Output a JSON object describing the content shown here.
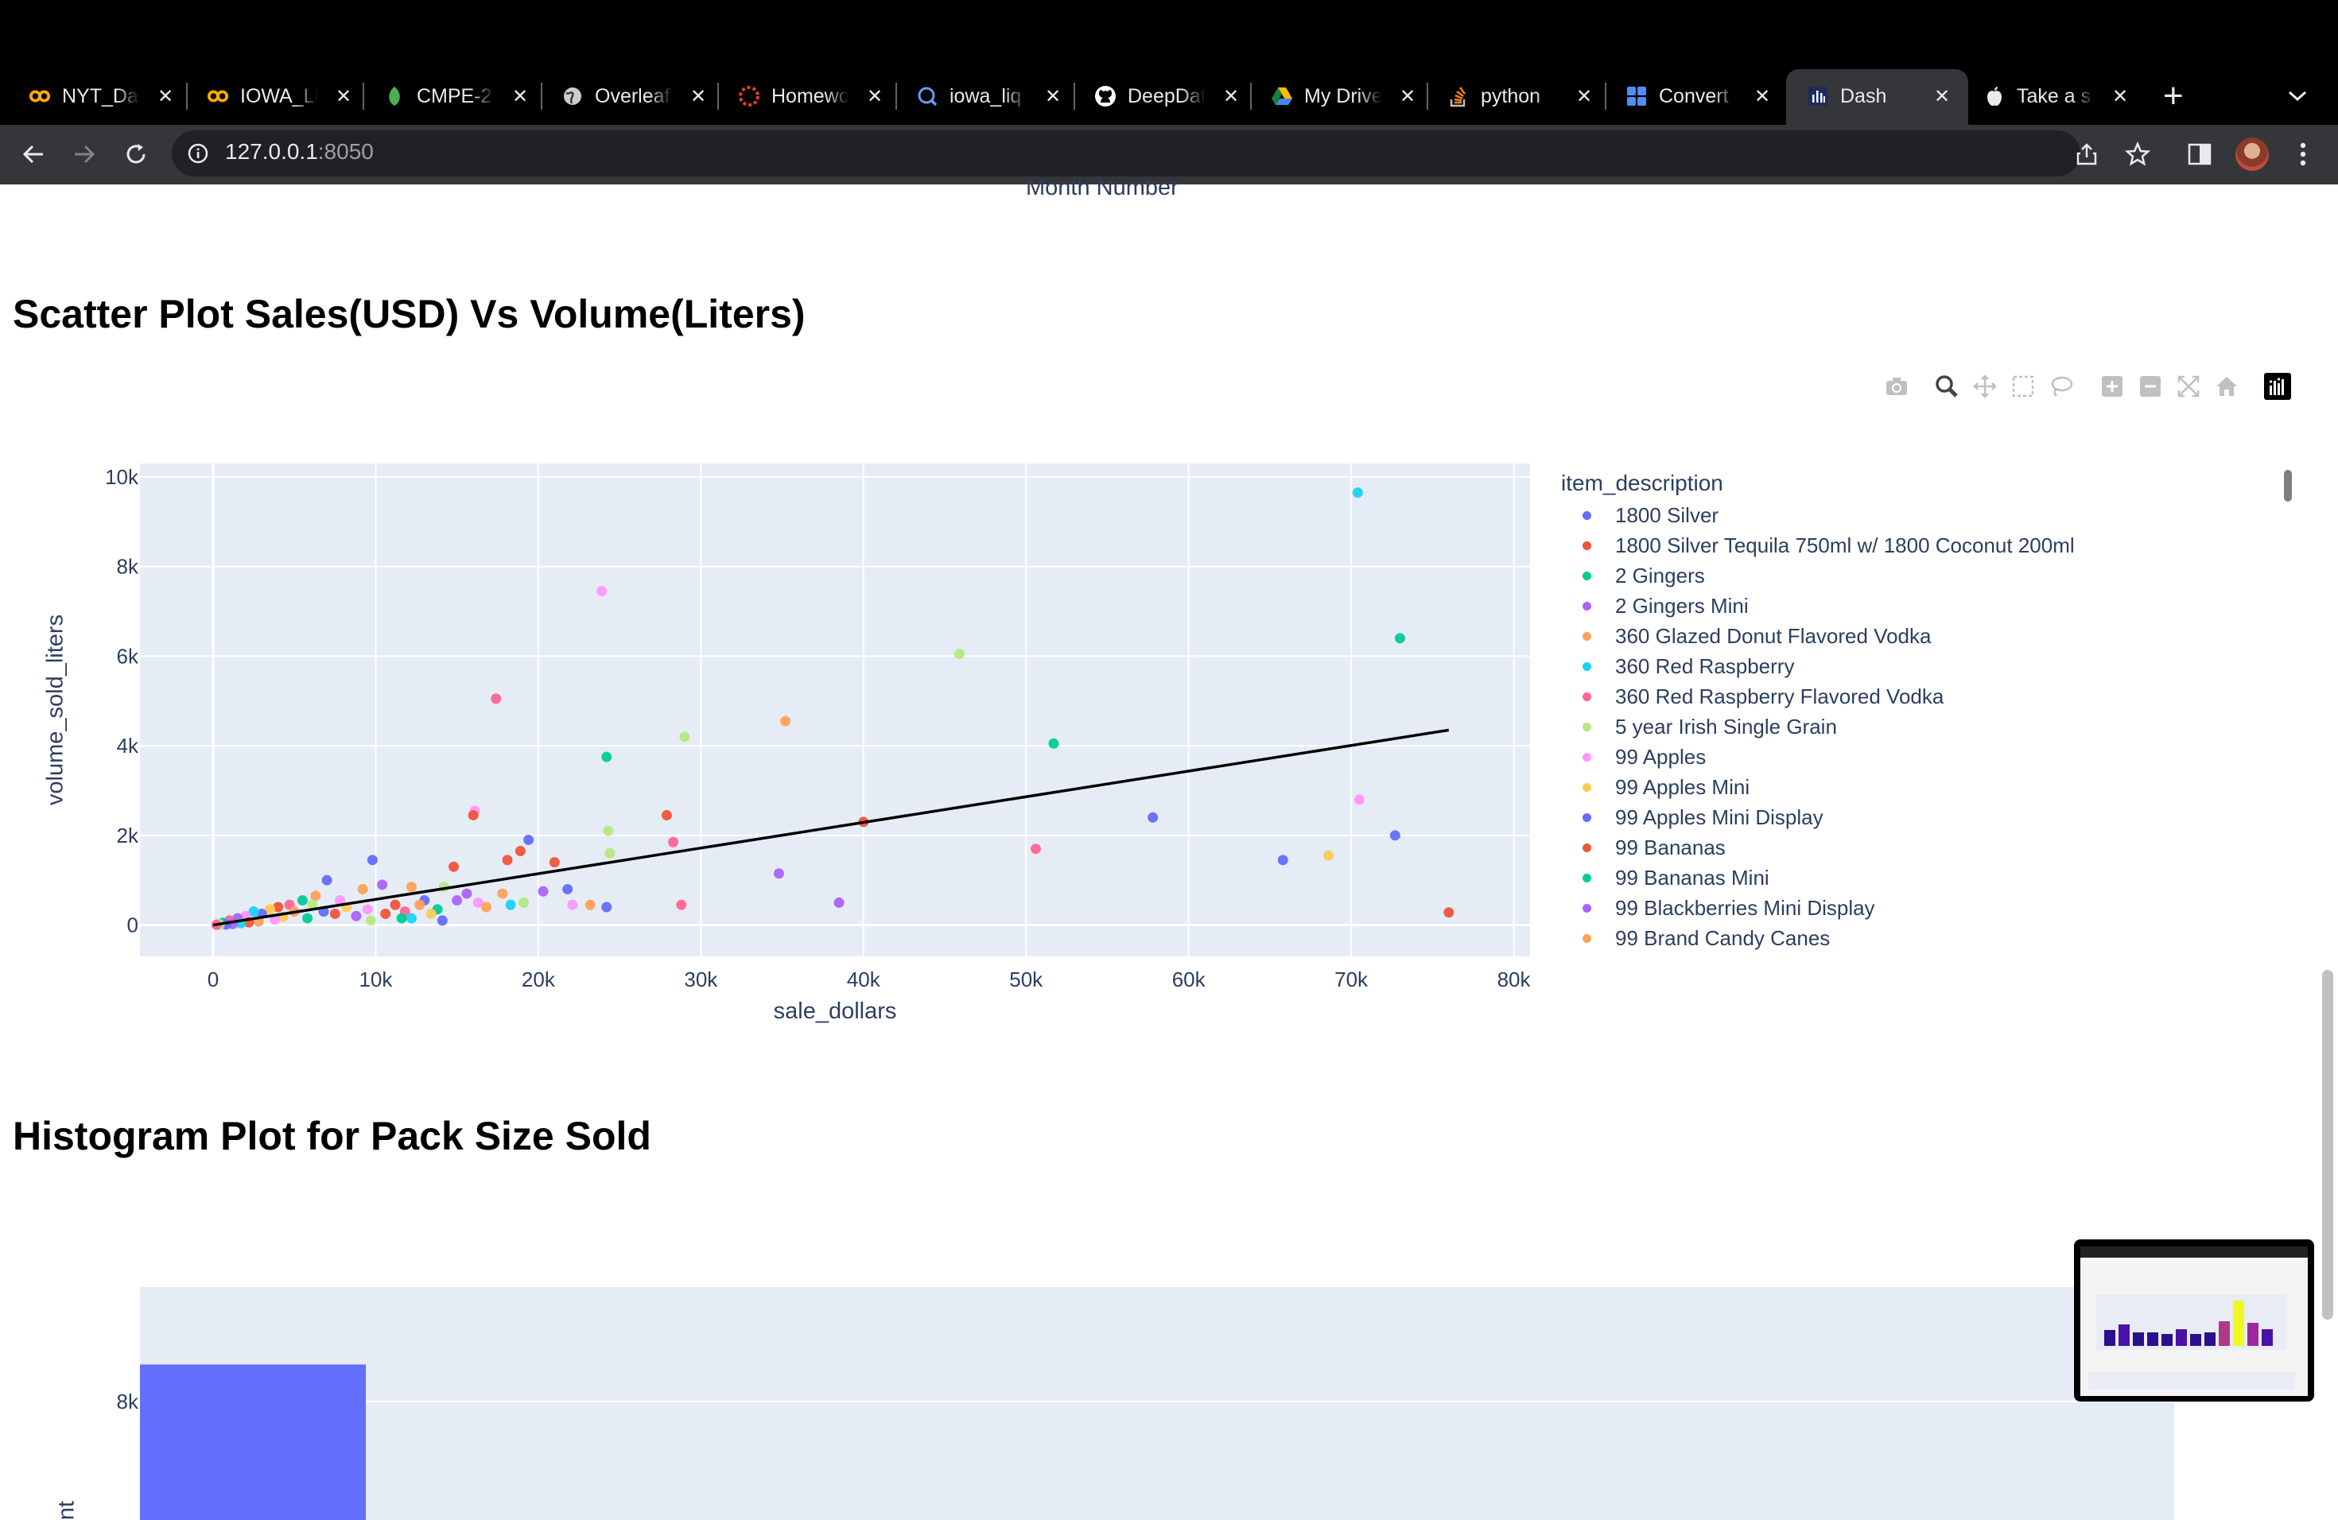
{
  "browser": {
    "tabs": [
      {
        "title": "NYT_Da",
        "icon": "colab-icon",
        "active": false
      },
      {
        "title": "IOWA_Li",
        "icon": "colab-icon",
        "active": false
      },
      {
        "title": "CMPE-2",
        "icon": "overleaf-leaf-icon",
        "active": false
      },
      {
        "title": "Overleaf",
        "icon": "globe-icon",
        "active": false
      },
      {
        "title": "Homewo",
        "icon": "canvas-icon",
        "active": false
      },
      {
        "title": "iowa_liq",
        "icon": "bigquery-icon",
        "active": false
      },
      {
        "title": "DeepDat",
        "icon": "github-icon",
        "active": false
      },
      {
        "title": "My Drive",
        "icon": "drive-icon",
        "active": false
      },
      {
        "title": "python",
        "icon": "stackoverflow-icon",
        "active": false
      },
      {
        "title": "Convert",
        "icon": "grid-app-icon",
        "active": false
      },
      {
        "title": "Dash",
        "icon": "dash-icon",
        "active": true
      },
      {
        "title": "Take a s",
        "icon": "apple-icon",
        "active": false
      }
    ],
    "url_host": "127.0.0.1",
    "url_port": ":8050"
  },
  "page": {
    "prev_axis_label": "Month Number",
    "scatter_heading": "Scatter Plot Sales(USD) Vs Volume(Liters)",
    "hist_heading": "Histogram Plot for Pack Size Sold",
    "modebar": [
      "camera-icon",
      "zoom-icon",
      "pan-icon",
      "box-select-icon",
      "lasso-icon",
      "zoom-in-icon",
      "zoom-out-icon",
      "autoscale-icon",
      "reset-axes-icon",
      "plotly-logo-icon"
    ]
  },
  "chart_data": [
    {
      "type": "scatter",
      "xlabel": "sale_dollars",
      "ylabel": "volume_sold_liters",
      "xlim": [
        -4500,
        81000
      ],
      "ylim": [
        -700,
        10300
      ],
      "xticks": [
        0,
        10000,
        20000,
        30000,
        40000,
        50000,
        60000,
        70000,
        80000
      ],
      "xtick_labels": [
        "0",
        "10k",
        "20k",
        "30k",
        "40k",
        "50k",
        "60k",
        "70k",
        "80k"
      ],
      "yticks": [
        0,
        2000,
        4000,
        6000,
        8000,
        10000
      ],
      "ytick_labels": [
        "0",
        "2k",
        "4k",
        "6k",
        "8k",
        "10k"
      ],
      "legend_title": "item_description",
      "legend_position": "right",
      "grid": true,
      "series": [
        {
          "name": "1800 Silver",
          "color": "#636efa"
        },
        {
          "name": "1800 Silver Tequila 750ml w/ 1800 Coconut 200ml",
          "color": "#ef553b"
        },
        {
          "name": "2 Gingers",
          "color": "#00cc96"
        },
        {
          "name": "2 Gingers Mini",
          "color": "#ab63fa"
        },
        {
          "name": "360 Glazed Donut Flavored Vodka",
          "color": "#ffa15a"
        },
        {
          "name": "360 Red Raspberry",
          "color": "#19d3f3"
        },
        {
          "name": "360 Red Raspberry Flavored Vodka",
          "color": "#ff6692"
        },
        {
          "name": "5 year Irish Single Grain",
          "color": "#b6e880"
        },
        {
          "name": "99 Apples",
          "color": "#ff97ff"
        },
        {
          "name": "99 Apples Mini",
          "color": "#fecb52"
        },
        {
          "name": "99 Apples Mini Display",
          "color": "#636efa"
        },
        {
          "name": "99 Bananas",
          "color": "#ef553b"
        },
        {
          "name": "99 Bananas Mini",
          "color": "#00cc96"
        },
        {
          "name": "99 Blackberries Mini Display",
          "color": "#ab63fa"
        },
        {
          "name": "99 Brand Candy Canes",
          "color": "#ffa15a"
        }
      ],
      "points": [
        [
          70400,
          9650,
          5
        ],
        [
          73000,
          6400,
          2
        ],
        [
          45900,
          6050,
          7
        ],
        [
          23900,
          7450,
          8
        ],
        [
          17400,
          5050,
          6
        ],
        [
          35200,
          4550,
          4
        ],
        [
          29000,
          4200,
          7
        ],
        [
          51700,
          4050,
          2
        ],
        [
          24200,
          3750,
          2
        ],
        [
          16100,
          2550,
          8
        ],
        [
          16000,
          2450,
          1
        ],
        [
          27900,
          2450,
          1
        ],
        [
          40000,
          2300,
          11
        ],
        [
          19400,
          1900,
          0
        ],
        [
          57800,
          2400,
          0
        ],
        [
          70500,
          2800,
          8
        ],
        [
          72700,
          2000,
          10
        ],
        [
          24300,
          2100,
          7
        ],
        [
          28300,
          1850,
          6
        ],
        [
          50600,
          1700,
          6
        ],
        [
          65800,
          1450,
          0
        ],
        [
          68600,
          1550,
          9
        ],
        [
          76000,
          280,
          1
        ],
        [
          18900,
          1650,
          11
        ],
        [
          21000,
          1400,
          1
        ],
        [
          24400,
          1600,
          7
        ],
        [
          18100,
          1450,
          1
        ],
        [
          14800,
          1300,
          11
        ],
        [
          9800,
          1450,
          10
        ],
        [
          34800,
          1150,
          13
        ],
        [
          38500,
          500,
          3
        ],
        [
          28800,
          450,
          6
        ],
        [
          24200,
          400,
          10
        ],
        [
          21800,
          800,
          0
        ],
        [
          20300,
          750,
          3
        ],
        [
          23200,
          450,
          4
        ],
        [
          22100,
          450,
          8
        ],
        [
          19100,
          500,
          7
        ],
        [
          18300,
          450,
          5
        ],
        [
          16300,
          500,
          8
        ],
        [
          17800,
          700,
          4
        ],
        [
          7000,
          1000,
          0
        ],
        [
          9200,
          800,
          4
        ],
        [
          10400,
          900,
          3
        ],
        [
          12200,
          850,
          4
        ],
        [
          14200,
          850,
          7
        ],
        [
          15000,
          550,
          3
        ],
        [
          13000,
          550,
          0
        ],
        [
          11200,
          450,
          1
        ],
        [
          11800,
          300,
          6
        ],
        [
          13800,
          350,
          2
        ],
        [
          12200,
          150,
          5
        ],
        [
          14100,
          100,
          0
        ],
        [
          9700,
          100,
          7
        ],
        [
          8200,
          400,
          9
        ],
        [
          6300,
          650,
          4
        ],
        [
          5500,
          550,
          2
        ],
        [
          4700,
          450,
          6
        ],
        [
          4000,
          400,
          11
        ],
        [
          3500,
          350,
          9
        ],
        [
          3000,
          250,
          0
        ],
        [
          2500,
          300,
          5
        ],
        [
          2000,
          200,
          8
        ],
        [
          1500,
          150,
          3
        ],
        [
          1000,
          100,
          6
        ],
        [
          600,
          50,
          2
        ],
        [
          300,
          30,
          7
        ],
        [
          6800,
          300,
          10
        ],
        [
          7500,
          250,
          11
        ],
        [
          8800,
          200,
          13
        ],
        [
          5800,
          150,
          12
        ],
        [
          4300,
          180,
          9
        ],
        [
          3800,
          120,
          8
        ],
        [
          2800,
          80,
          4
        ],
        [
          2200,
          60,
          1
        ],
        [
          1700,
          40,
          5
        ],
        [
          1200,
          20,
          3
        ],
        [
          800,
          10,
          0
        ],
        [
          400,
          5,
          7
        ],
        [
          200,
          2,
          6
        ],
        [
          9500,
          350,
          8
        ],
        [
          10600,
          250,
          1
        ],
        [
          11600,
          150,
          12
        ],
        [
          12700,
          450,
          14
        ],
        [
          13400,
          250,
          9
        ],
        [
          15600,
          700,
          3
        ],
        [
          16800,
          400,
          4
        ],
        [
          6100,
          450,
          7
        ],
        [
          7800,
          550,
          8
        ],
        [
          5000,
          300,
          14
        ]
      ],
      "trendline": {
        "x": [
          0,
          76000
        ],
        "y": [
          0,
          4350
        ]
      }
    },
    {
      "type": "bar",
      "title": "",
      "yticks": [
        6000,
        8000
      ],
      "ytick_labels": [
        "6k",
        "8k"
      ],
      "ylabel_visible_fragment": "nt",
      "first_bar_value": 8550,
      "ylim": [
        5200,
        9700
      ],
      "bar_color": "#636efa"
    }
  ]
}
